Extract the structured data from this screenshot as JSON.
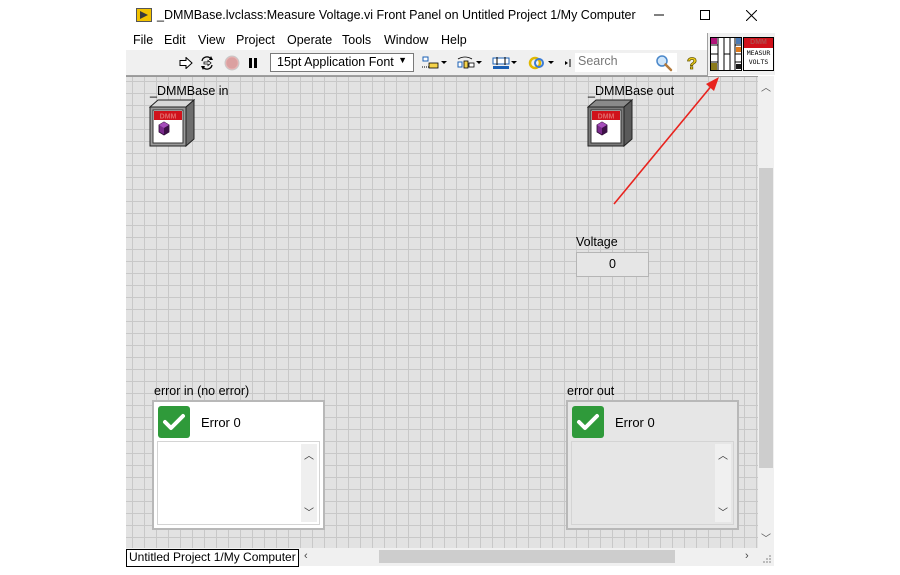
{
  "window": {
    "title": "_DMMBase.lvclass:Measure Voltage.vi Front Panel on Untitled Project 1/My Computer",
    "app_icon": "labview-front-panel-icon",
    "controls": {
      "minimize": "minimize-icon",
      "maximize": "maximize-icon",
      "close": "close-icon"
    }
  },
  "menubar": {
    "items": [
      "File",
      "Edit",
      "View",
      "Project",
      "Operate",
      "Tools",
      "Window",
      "Help"
    ]
  },
  "toolbar": {
    "run": "run-arrow-icon",
    "run_continuously": "run-continuously-icon",
    "abort": "abort-execution-icon",
    "pause": "pause-icon",
    "font_select": "15pt Application Font",
    "align": "align-objects-icon",
    "distribute": "distribute-objects-icon",
    "resize": "resize-objects-icon",
    "reorder": "reorder-icon",
    "search_placeholder": "Search",
    "search_icon": "magnifier-icon",
    "help_icon": "context-help-icon"
  },
  "vi_icon": {
    "header": "DMM",
    "line1": "MEASUR",
    "line2": "VOLTS"
  },
  "front_panel": {
    "dmm_in": {
      "label": "_DMMBase in",
      "icon_text": "DMM"
    },
    "dmm_out": {
      "label": "_DMMBase out",
      "icon_text": "DMM"
    },
    "voltage": {
      "label": "Voltage",
      "value": "0"
    },
    "error_in": {
      "label": "error in (no error)",
      "code_text": "Error 0",
      "status": "no-error"
    },
    "error_out": {
      "label": "error out",
      "code_text": "Error 0",
      "status": "no-error"
    }
  },
  "statusbar": {
    "context": "Untitled Project 1/My Computer"
  },
  "annotation": {
    "arrow_color": "#e8231e"
  },
  "colors": {
    "status_ok": "#2f9a3a",
    "dmm_red": "#d0121b",
    "dmm_purple": "#7a2a8c"
  }
}
